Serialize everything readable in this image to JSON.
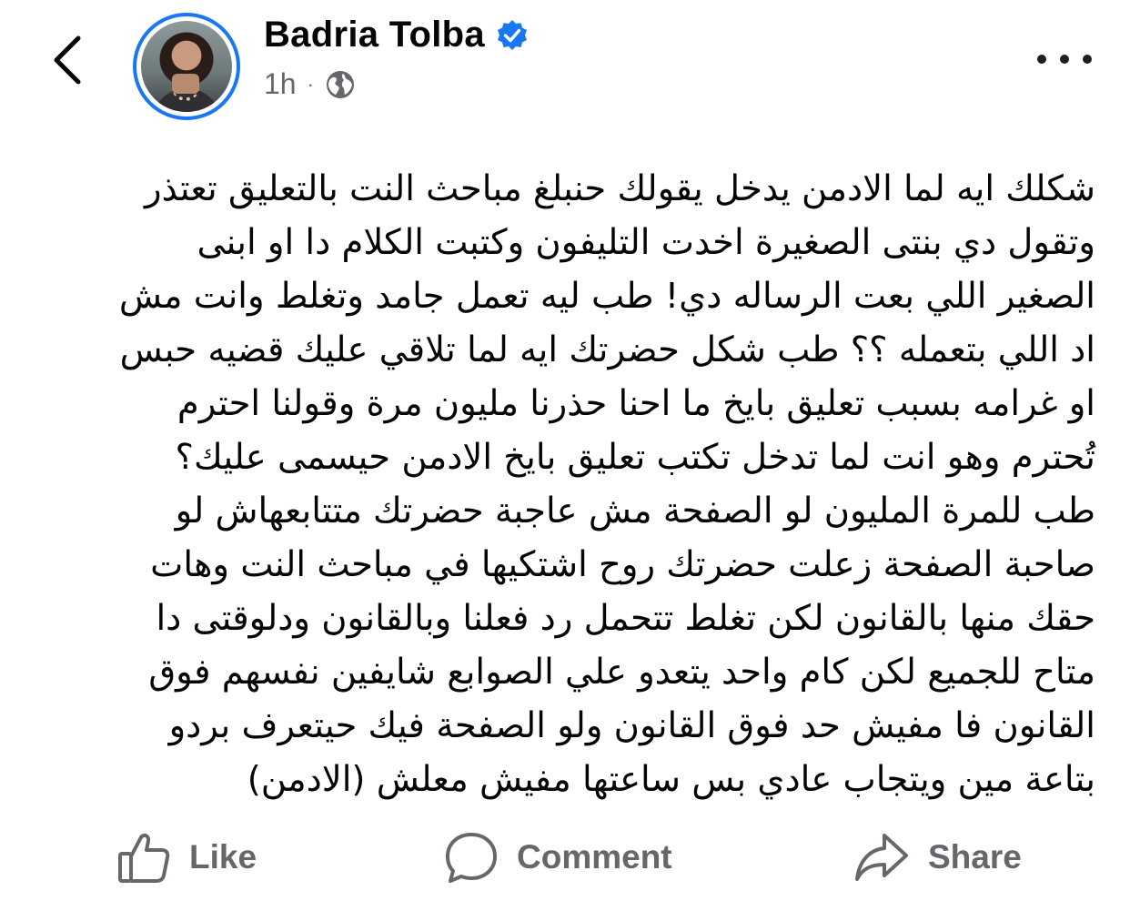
{
  "header": {
    "back_icon": "chevron-left-icon",
    "author_name": "Badria Tolba",
    "verified_icon": "verified-badge-icon",
    "time": "1h",
    "separator": "·",
    "audience_icon": "globe-icon",
    "more_icon": "more-horizontal-icon",
    "accent_color": "#1877f2"
  },
  "post": {
    "lines": [
      "شكلك ايه لما الادمن يدخل يقولك حنبلغ مباحث النت بالتعليق تعتذر",
      "وتقول دي بنتى الصغيرة اخدت التليفون وكتبت الكلام دا او ابنى",
      "الصغير اللي بعت الرساله دي! طب ليه تعمل جامد وتغلط وانت مش",
      "اد اللي بتعمله ؟؟ طب شكل حضرتك ايه لما تلاقي عليك قضيه حبس",
      "او غرامه بسبب تعليق بايخ ما احنا حذرنا مليون مرة وقولنا احترم",
      "تُحترم وهو انت لما تدخل تكتب تعليق بايخ الادمن حيسمى عليك؟",
      "طب للمرة المليون لو الصفحة مش عاجبة حضرتك متتابعهاش لو",
      "صاحبة الصفحة زعلت حضرتك روح اشتكيها في مباحث النت وهات",
      "حقك منها بالقانون لكن تغلط تتحمل رد فعلنا وبالقانون ودلوقتى دا",
      "متاح للجميع لكن كام واحد يتعدو علي الصوابع شايفين نفسهم فوق",
      "القانون فا مفيش حد فوق القانون ولو الصفحة فيك حيتعرف بردو",
      "بتاعة مين ويتجاب عادي بس ساعتها مفيش معلش (الادمن)"
    ]
  },
  "actions": {
    "like_label": "Like",
    "like_icon": "thumbs-up-icon",
    "comment_label": "Comment",
    "comment_icon": "comment-bubble-icon",
    "share_label": "Share",
    "share_icon": "share-arrow-icon"
  }
}
